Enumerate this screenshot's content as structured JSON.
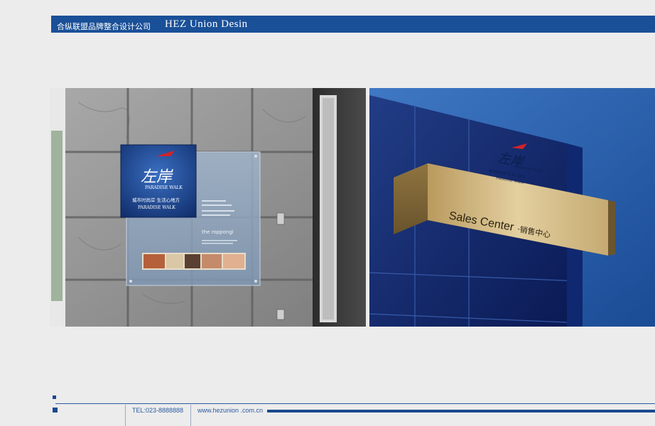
{
  "header": {
    "company_cn": "合纵联盟品牌整合设计公司",
    "company_en": "HEZ Union Desin"
  },
  "left_photo": {
    "sign_logo_cn": "左岸",
    "sign_logo_en": "PARADISE WALK",
    "sign_slogan": "城市时尚岸 生活心地方",
    "sign_brand": "PARADISE WALK",
    "panel_brand": "the roppongi"
  },
  "right_photo": {
    "building_logo_cn": "左岸",
    "building_logo_en": "PARADISE WALK",
    "building_slogan": "城市时尚岸 生活心地方",
    "building_brand": "PARADISE WALK",
    "sales_center_en": "Sales Center",
    "sales_center_cn": "·销售中心"
  },
  "footer": {
    "tel": "TEL:023-8888888",
    "website": "www.hezunion .com.cn"
  }
}
